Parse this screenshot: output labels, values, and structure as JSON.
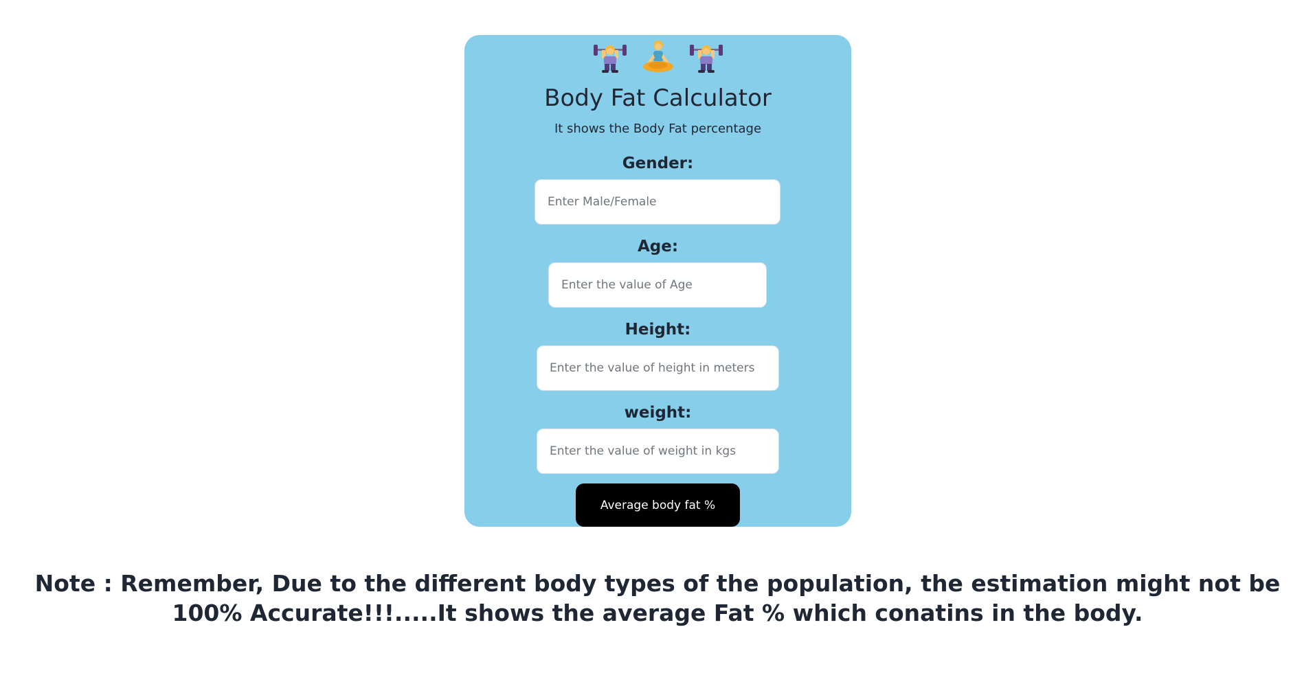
{
  "header": {
    "icons": [
      "woman-lifting-weights-icon",
      "woman-in-lotus-position-icon",
      "woman-lifting-weights-icon"
    ]
  },
  "calculator": {
    "title": "Body Fat Calculator",
    "subtitle": "It shows the Body Fat percentage",
    "fields": {
      "gender": {
        "label": "Gender:",
        "placeholder": "Enter Male/Female",
        "value": ""
      },
      "age": {
        "label": "Age:",
        "placeholder": "Enter the value of Age",
        "value": ""
      },
      "height": {
        "label": "Height:",
        "placeholder": "Enter the value of height in meters",
        "value": ""
      },
      "weight": {
        "label": "weight:",
        "placeholder": "Enter the value of weight in kgs",
        "value": ""
      }
    },
    "button_label": "Average body fat %"
  },
  "note": "Note : Remember, Due to the different body types of the population, the estimation might not be 100% Accurate!!!.....It shows the average Fat % which conatins in the body.",
  "colors": {
    "card_background": "#87ceeb",
    "button_background": "#000000",
    "button_text": "#ffffff",
    "text": "#1e2733"
  }
}
